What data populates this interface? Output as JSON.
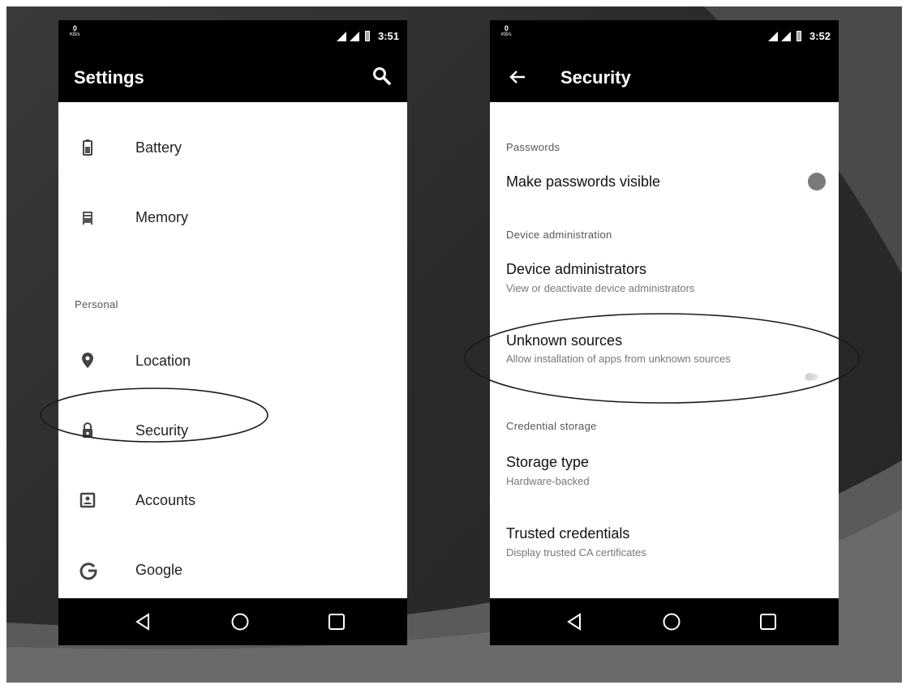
{
  "left_screen": {
    "status": {
      "kbs_value": "0",
      "kbs_unit": "KB/s",
      "time": "3:51"
    },
    "appbar": {
      "title": "Settings",
      "search_icon": "search-icon"
    },
    "items": [
      {
        "label": "Battery",
        "icon": "battery-icon"
      },
      {
        "label": "Memory",
        "icon": "memory-icon"
      },
      {
        "label": "Location",
        "icon": "location-pin-icon"
      },
      {
        "label": "Security",
        "icon": "lock-icon",
        "highlighted": true
      },
      {
        "label": "Accounts",
        "icon": "account-icon"
      },
      {
        "label": "Google",
        "icon": "google-icon"
      }
    ],
    "section_personal": "Personal"
  },
  "right_screen": {
    "status": {
      "kbs_value": "0",
      "kbs_unit": "KB/s",
      "time": "3:52"
    },
    "appbar": {
      "title": "Security",
      "back_icon": "back-arrow-icon"
    },
    "sections": {
      "passwords": "Passwords",
      "device_admin": "Device administration",
      "credential_storage": "Credential storage"
    },
    "prefs": {
      "make_passwords_visible": {
        "title": "Make passwords visible",
        "toggle_on": false
      },
      "device_administrators": {
        "title": "Device administrators",
        "summary": "View or deactivate device administrators"
      },
      "unknown_sources": {
        "title": "Unknown sources",
        "summary": "Allow installation of apps from unknown sources",
        "toggle_on": false,
        "highlighted": true
      },
      "storage_type": {
        "title": "Storage type",
        "summary": "Hardware-backed"
      },
      "trusted_credentials": {
        "title": "Trusted credentials",
        "summary": "Display trusted CA certificates"
      }
    }
  },
  "navbar_icons": [
    "back-triangle-icon",
    "home-circle-icon",
    "recents-square-icon"
  ],
  "colors": {
    "bar": "#000000",
    "background": "#2b2b2b",
    "highlight_ring": "#1a1a1a"
  }
}
